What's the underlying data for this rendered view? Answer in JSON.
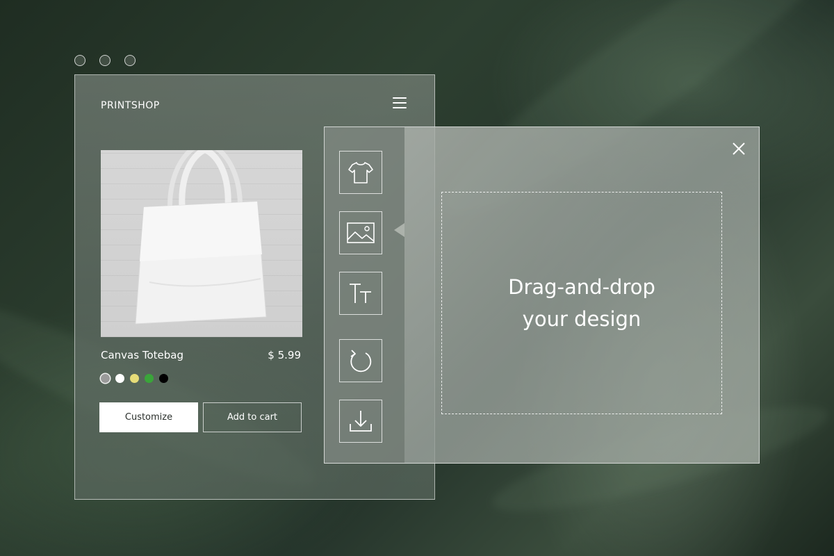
{
  "window": {
    "dots": [
      "dot-1",
      "dot-2",
      "dot-3"
    ]
  },
  "shop": {
    "brand": "PRINTSHOP",
    "menu_icon": "hamburger-menu-icon",
    "product": {
      "image_icon": "tote-bag-image",
      "name": "Canvas Totebag",
      "price": "$ 5.99",
      "swatches": [
        {
          "color": "#9a9a9a",
          "selected": true
        },
        {
          "color": "#ffffff",
          "selected": false
        },
        {
          "color": "#e6dc78",
          "selected": false
        },
        {
          "color": "#3aa53a",
          "selected": false
        },
        {
          "color": "#000000",
          "selected": false
        }
      ]
    },
    "buttons": {
      "customize": "Customize",
      "add_to_cart": "Add to cart"
    }
  },
  "editor": {
    "tools": [
      {
        "name": "tshirt-icon"
      },
      {
        "name": "image-icon",
        "active": true
      },
      {
        "name": "text-icon"
      },
      {
        "name": "rotate-icon"
      },
      {
        "name": "download-icon"
      }
    ],
    "close_icon": "close-icon",
    "drop_zone": {
      "line1": "Drag-and-drop",
      "line2": "your design"
    }
  },
  "colors": {
    "accent_white": "#ffffff",
    "button_text": "#2a2f2b"
  }
}
